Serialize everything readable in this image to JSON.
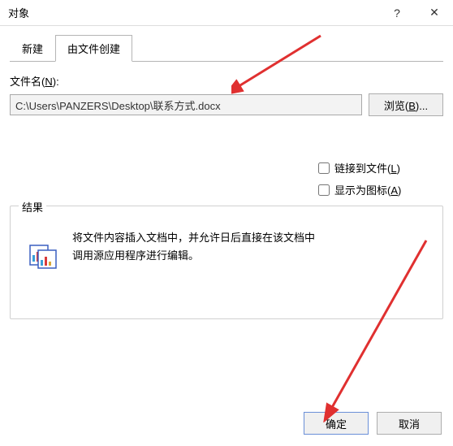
{
  "titlebar": {
    "title": "对象"
  },
  "tabs": {
    "new_tab": "新建",
    "from_file_tab": "由文件创建"
  },
  "file": {
    "label_prefix": "文件名(",
    "label_key": "N",
    "label_suffix": "):",
    "value": "C:\\Users\\PANZERS\\Desktop\\联系方式.docx"
  },
  "browse": {
    "label_prefix": "浏览(",
    "label_key": "B",
    "label_suffix": ")..."
  },
  "options": {
    "link_prefix": "链接到文件(",
    "link_key": "L",
    "link_suffix": ")",
    "icon_prefix": "显示为图标(",
    "icon_key": "A",
    "icon_suffix": ")"
  },
  "result": {
    "legend": "结果",
    "text": "将文件内容插入文档中，并允许日后直接在该文档中调用源应用程序进行编辑。"
  },
  "footer": {
    "ok": "确定",
    "cancel": "取消"
  }
}
